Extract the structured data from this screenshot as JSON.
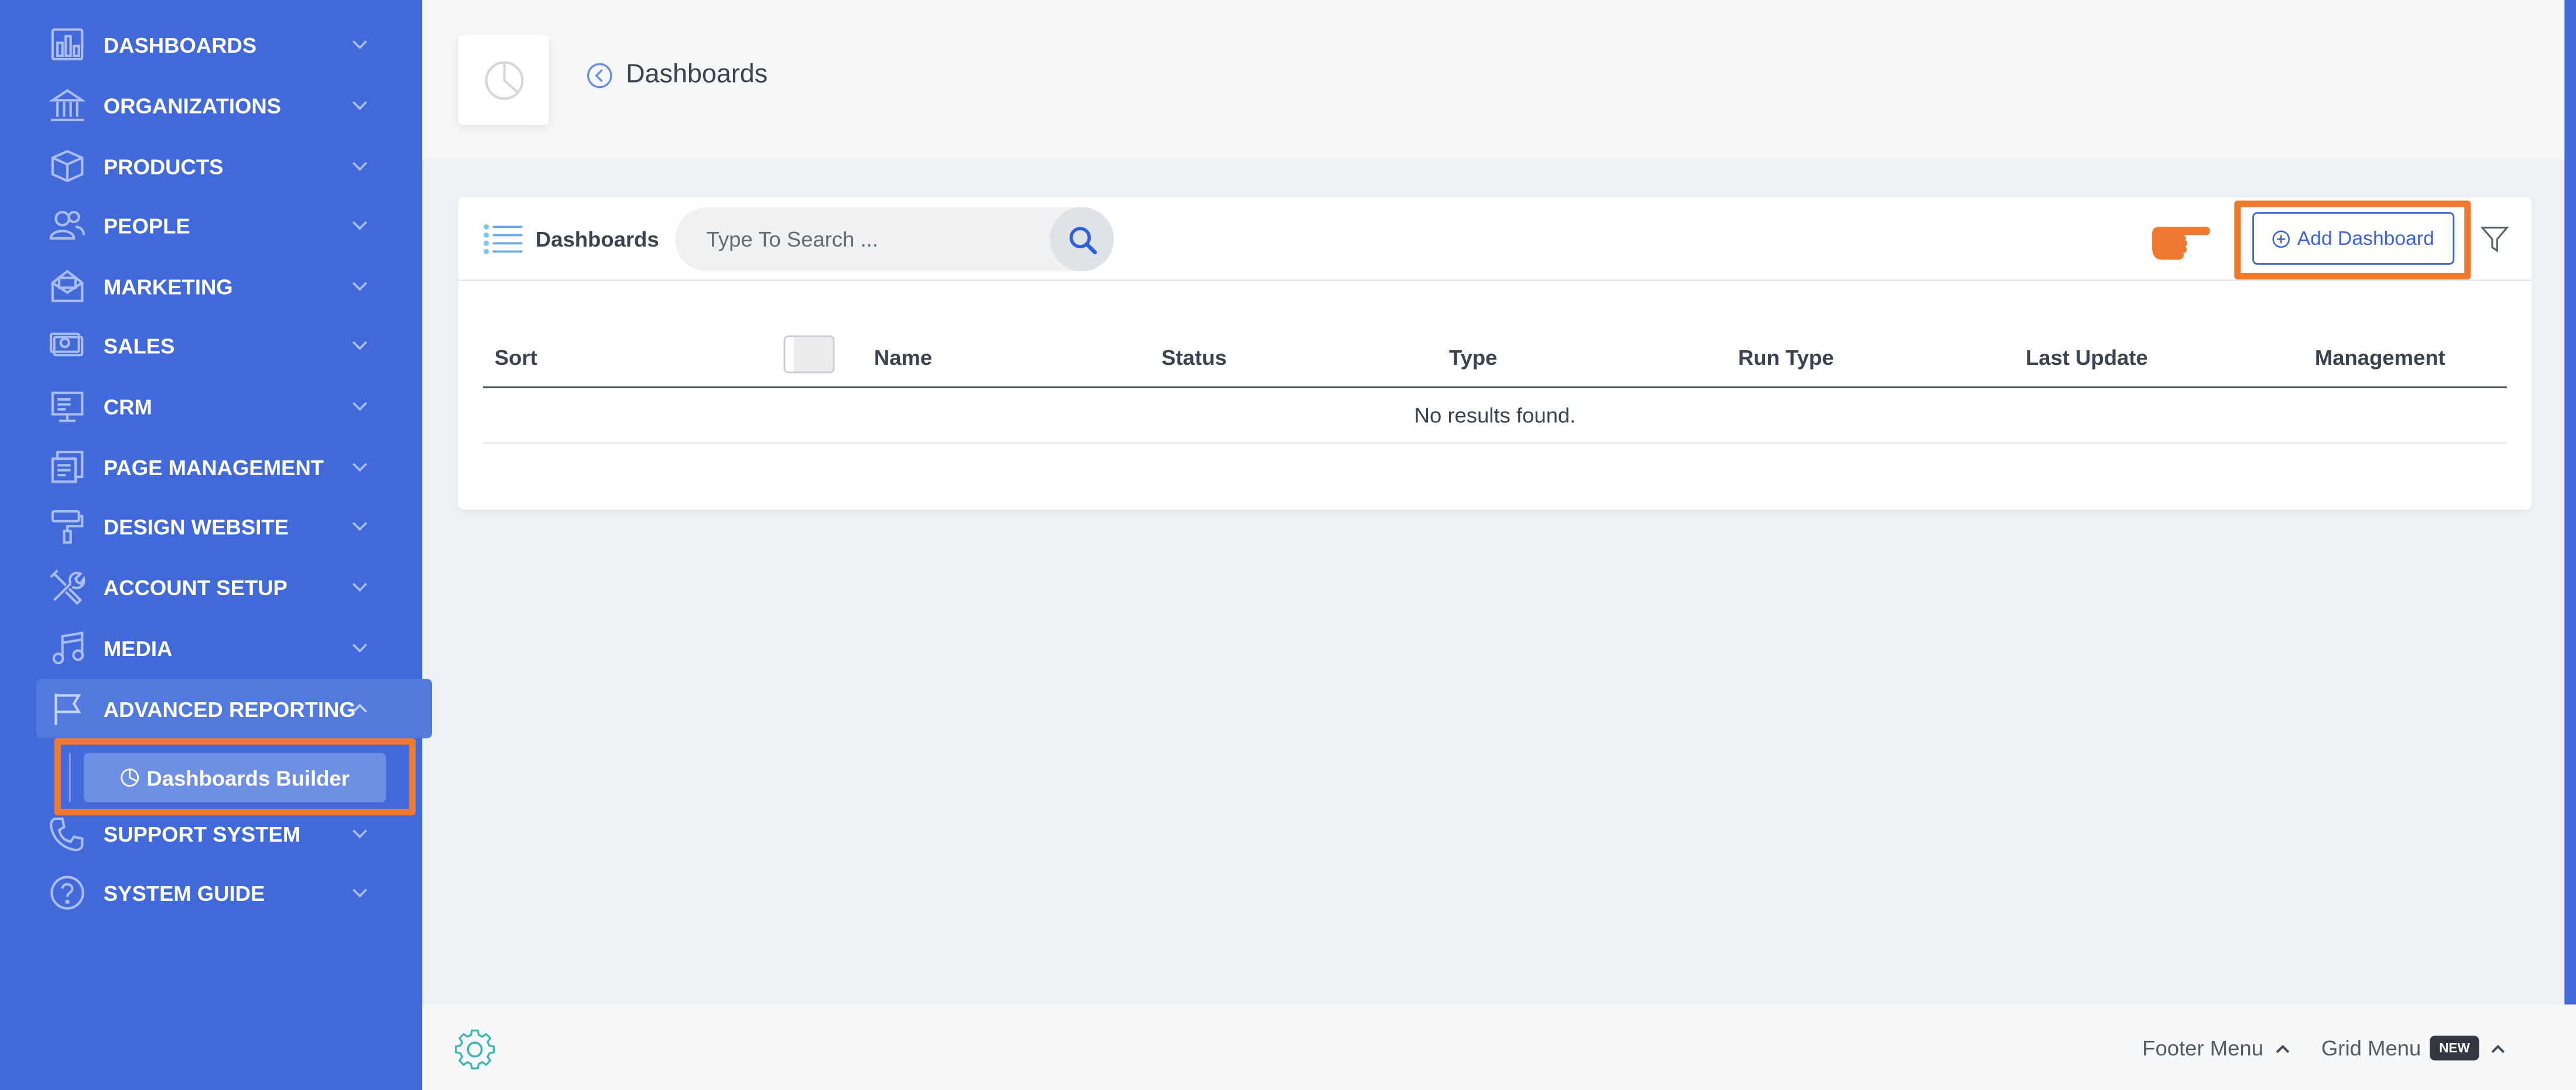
{
  "sidebar": {
    "items": [
      {
        "label": "DASHBOARDS",
        "icon": "bar-chart-icon"
      },
      {
        "label": "ORGANIZATIONS",
        "icon": "building-icon"
      },
      {
        "label": "PRODUCTS",
        "icon": "box-icon"
      },
      {
        "label": "PEOPLE",
        "icon": "people-icon"
      },
      {
        "label": "MARKETING",
        "icon": "envelope-icon"
      },
      {
        "label": "SALES",
        "icon": "cash-icon"
      },
      {
        "label": "CRM",
        "icon": "monitor-icon"
      },
      {
        "label": "PAGE MANAGEMENT",
        "icon": "pages-icon"
      },
      {
        "label": "DESIGN WEBSITE",
        "icon": "paint-roller-icon"
      },
      {
        "label": "ACCOUNT SETUP",
        "icon": "tools-icon"
      },
      {
        "label": "MEDIA",
        "icon": "music-icon"
      },
      {
        "label": "ADVANCED REPORTING",
        "icon": "flag-icon",
        "expanded": true
      },
      {
        "label": "SUPPORT SYSTEM",
        "icon": "phone-icon"
      },
      {
        "label": "SYSTEM GUIDE",
        "icon": "question-icon"
      }
    ],
    "sub_item": {
      "label": "Dashboards Builder",
      "icon": "pie-chart-icon"
    }
  },
  "header": {
    "title": "Dashboards"
  },
  "card": {
    "title": "Dashboards",
    "search_placeholder": "Type To Search ...",
    "add_button_label": "Add Dashboard",
    "columns": [
      "Sort",
      "Name",
      "Status",
      "Type",
      "Run Type",
      "Last Update",
      "Management"
    ],
    "empty_message": "No results found."
  },
  "footer": {
    "footer_menu_label": "Footer Menu",
    "grid_menu_label": "Grid Menu",
    "new_badge": "NEW"
  },
  "colors": {
    "sidebar": "#4169d9",
    "accent": "#3c63d6",
    "highlight": "#ee7a30"
  }
}
